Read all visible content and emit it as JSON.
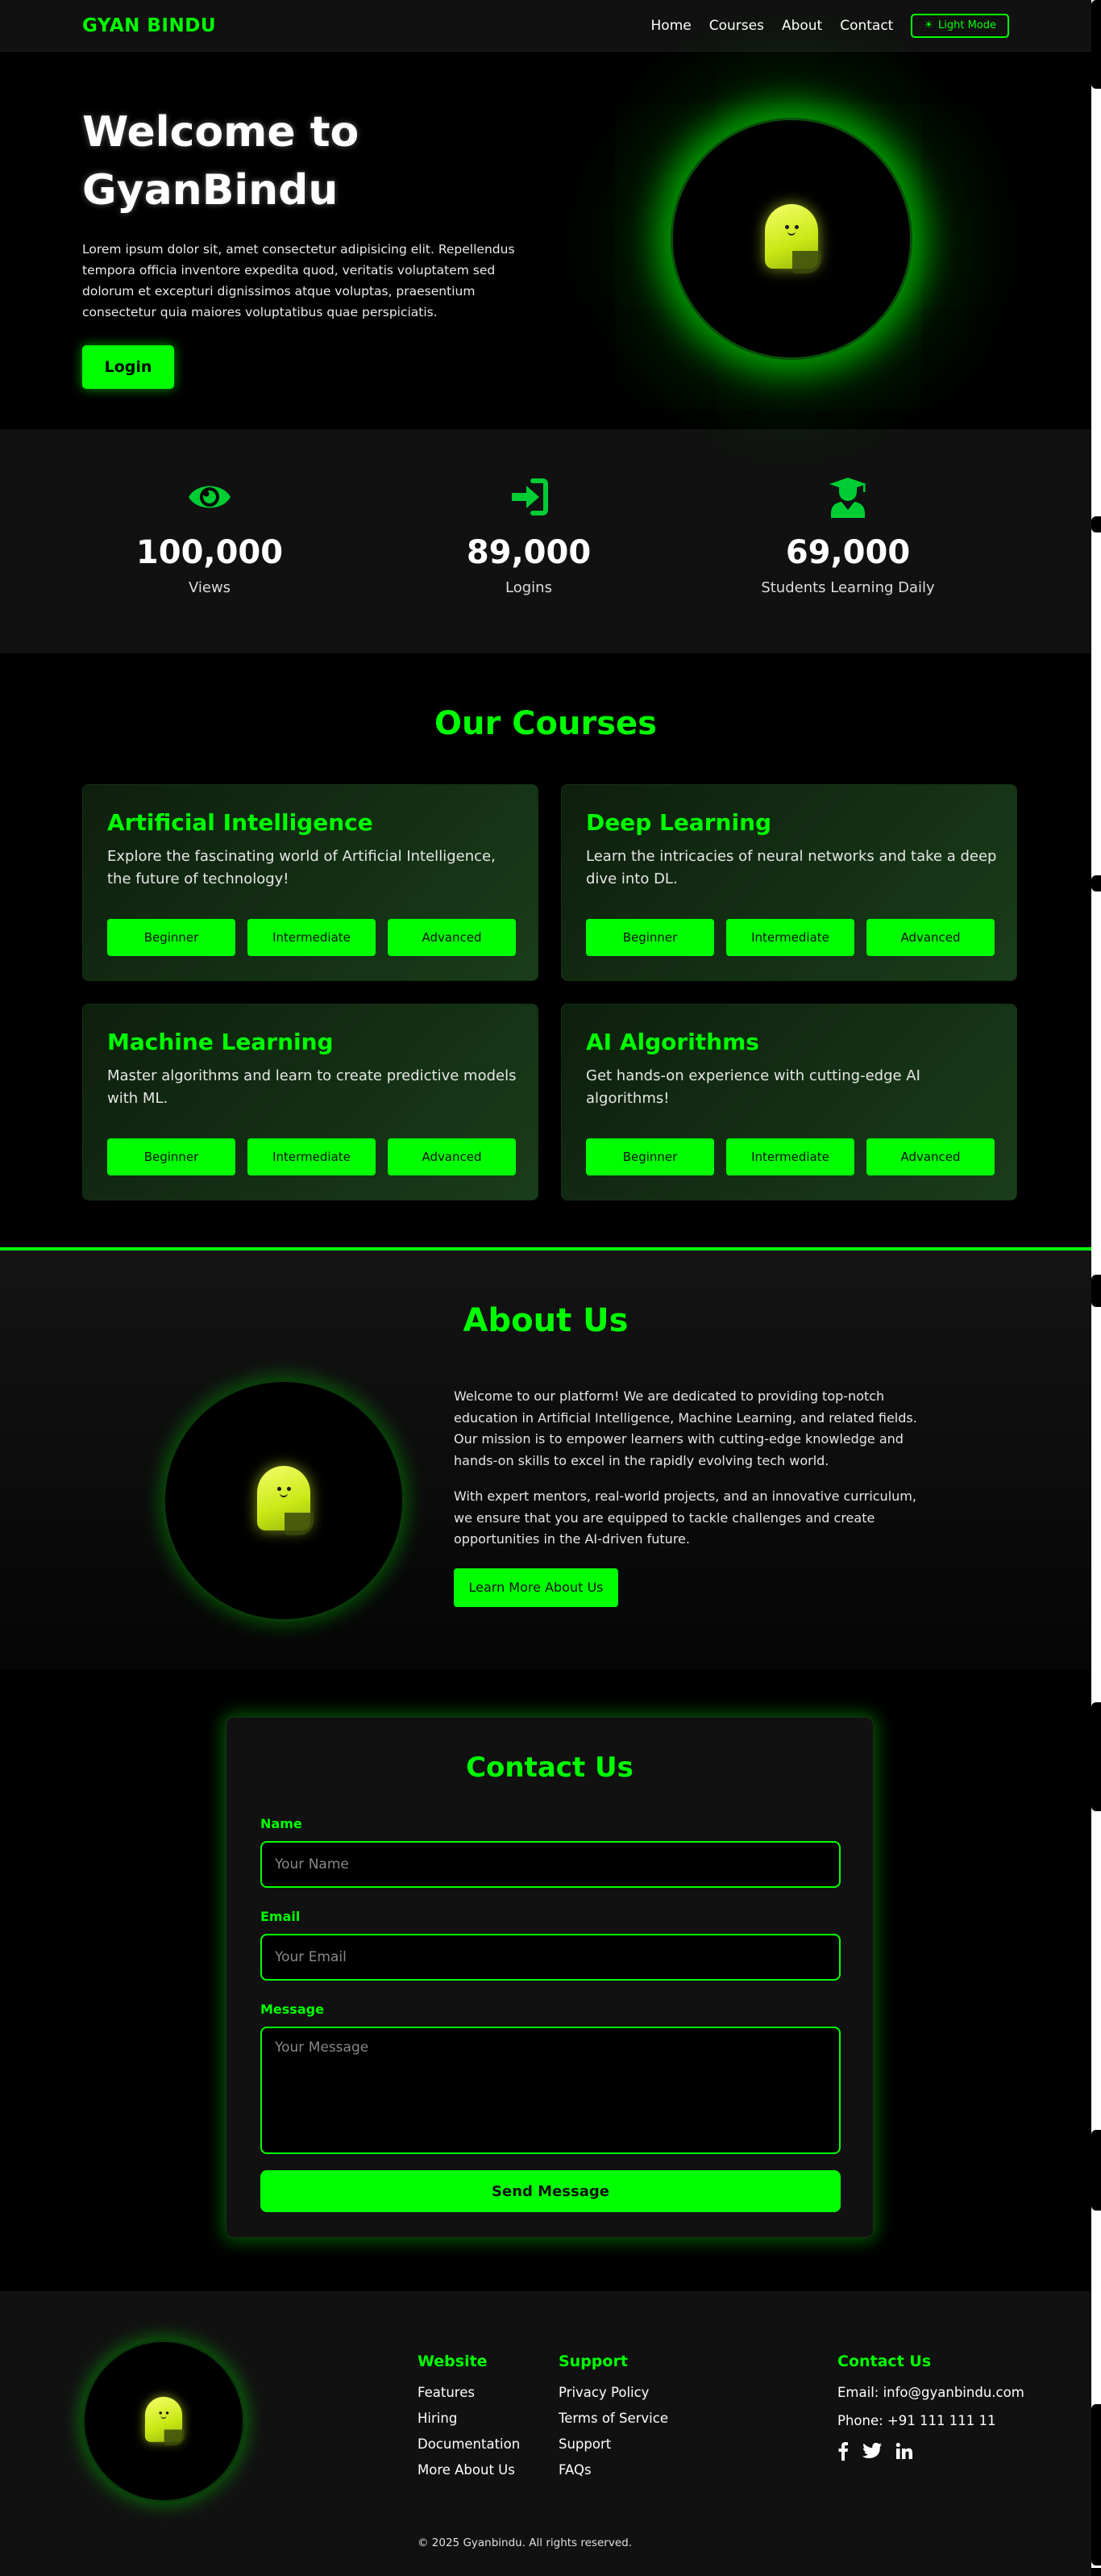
{
  "nav": {
    "brand": "GYAN BINDU",
    "links": [
      "Home",
      "Courses",
      "About",
      "Contact"
    ],
    "mode_toggle": "Light Mode"
  },
  "hero": {
    "title_line1": "Welcome to",
    "title_line2": "GyanBindu",
    "description": "Lorem ipsum dolor sit, amet consectetur adipisicing elit. Repellendus tempora officia inventore expedita quod, veritatis voluptatem sed dolorum et excepturi dignissimos atque voluptas, praesentium consectetur quia maiores voluptatibus quae perspiciatis.",
    "login_label": "Login"
  },
  "stats": [
    {
      "icon": "eye-icon",
      "value": "100,000",
      "label": "Views"
    },
    {
      "icon": "sign-in-icon",
      "value": "89,000",
      "label": "Logins"
    },
    {
      "icon": "graduate-icon",
      "value": "69,000",
      "label": "Students Learning Daily"
    }
  ],
  "courses": {
    "title": "Our Courses",
    "items": [
      {
        "title": "Artificial Intelligence",
        "description": "Explore the fascinating world of Artificial Intelligence, the future of technology!"
      },
      {
        "title": "Deep Learning",
        "description": "Learn the intricacies of neural networks and take a deep dive into DL."
      },
      {
        "title": "Machine Learning",
        "description": "Master algorithms and learn to create predictive models with ML."
      },
      {
        "title": "AI Algorithms",
        "description": "Get hands-on experience with cutting-edge AI algorithms!"
      }
    ],
    "levels": [
      "Beginner",
      "Intermediate",
      "Advanced"
    ]
  },
  "about": {
    "title": "About Us",
    "paragraph1": "Welcome to our platform! We are dedicated to providing top-notch education in Artificial Intelligence, Machine Learning, and related fields. Our mission is to empower learners with cutting-edge knowledge and hands-on skills to excel in the rapidly evolving tech world.",
    "paragraph2": "With expert mentors, real-world projects, and an innovative curriculum, we ensure that you are equipped to tackle challenges and create opportunities in the AI-driven future.",
    "button_label": "Learn More About Us"
  },
  "contact": {
    "title": "Contact Us",
    "name_label": "Name",
    "name_placeholder": "Your Name",
    "email_label": "Email",
    "email_placeholder": "Your Email",
    "message_label": "Message",
    "message_placeholder": "Your Message",
    "send_label": "Send Message"
  },
  "footer": {
    "website": {
      "heading": "Website",
      "links": [
        "Features",
        "Hiring",
        "Documentation",
        "More About Us"
      ]
    },
    "support": {
      "heading": "Support",
      "links": [
        "Privacy Policy",
        "Terms of Service",
        "Support",
        "FAQs"
      ]
    },
    "contact": {
      "heading": "Contact Us",
      "email": "Email: info@gyanbindu.com",
      "phone": "Phone: +91 111 111 11"
    },
    "socials": [
      "facebook-icon",
      "twitter-icon",
      "linkedin-icon"
    ],
    "copyright": "© 2025 Gyanbindu. All rights reserved."
  },
  "colors": {
    "accent": "#00ff00",
    "background": "#000000",
    "panel": "#111111"
  }
}
